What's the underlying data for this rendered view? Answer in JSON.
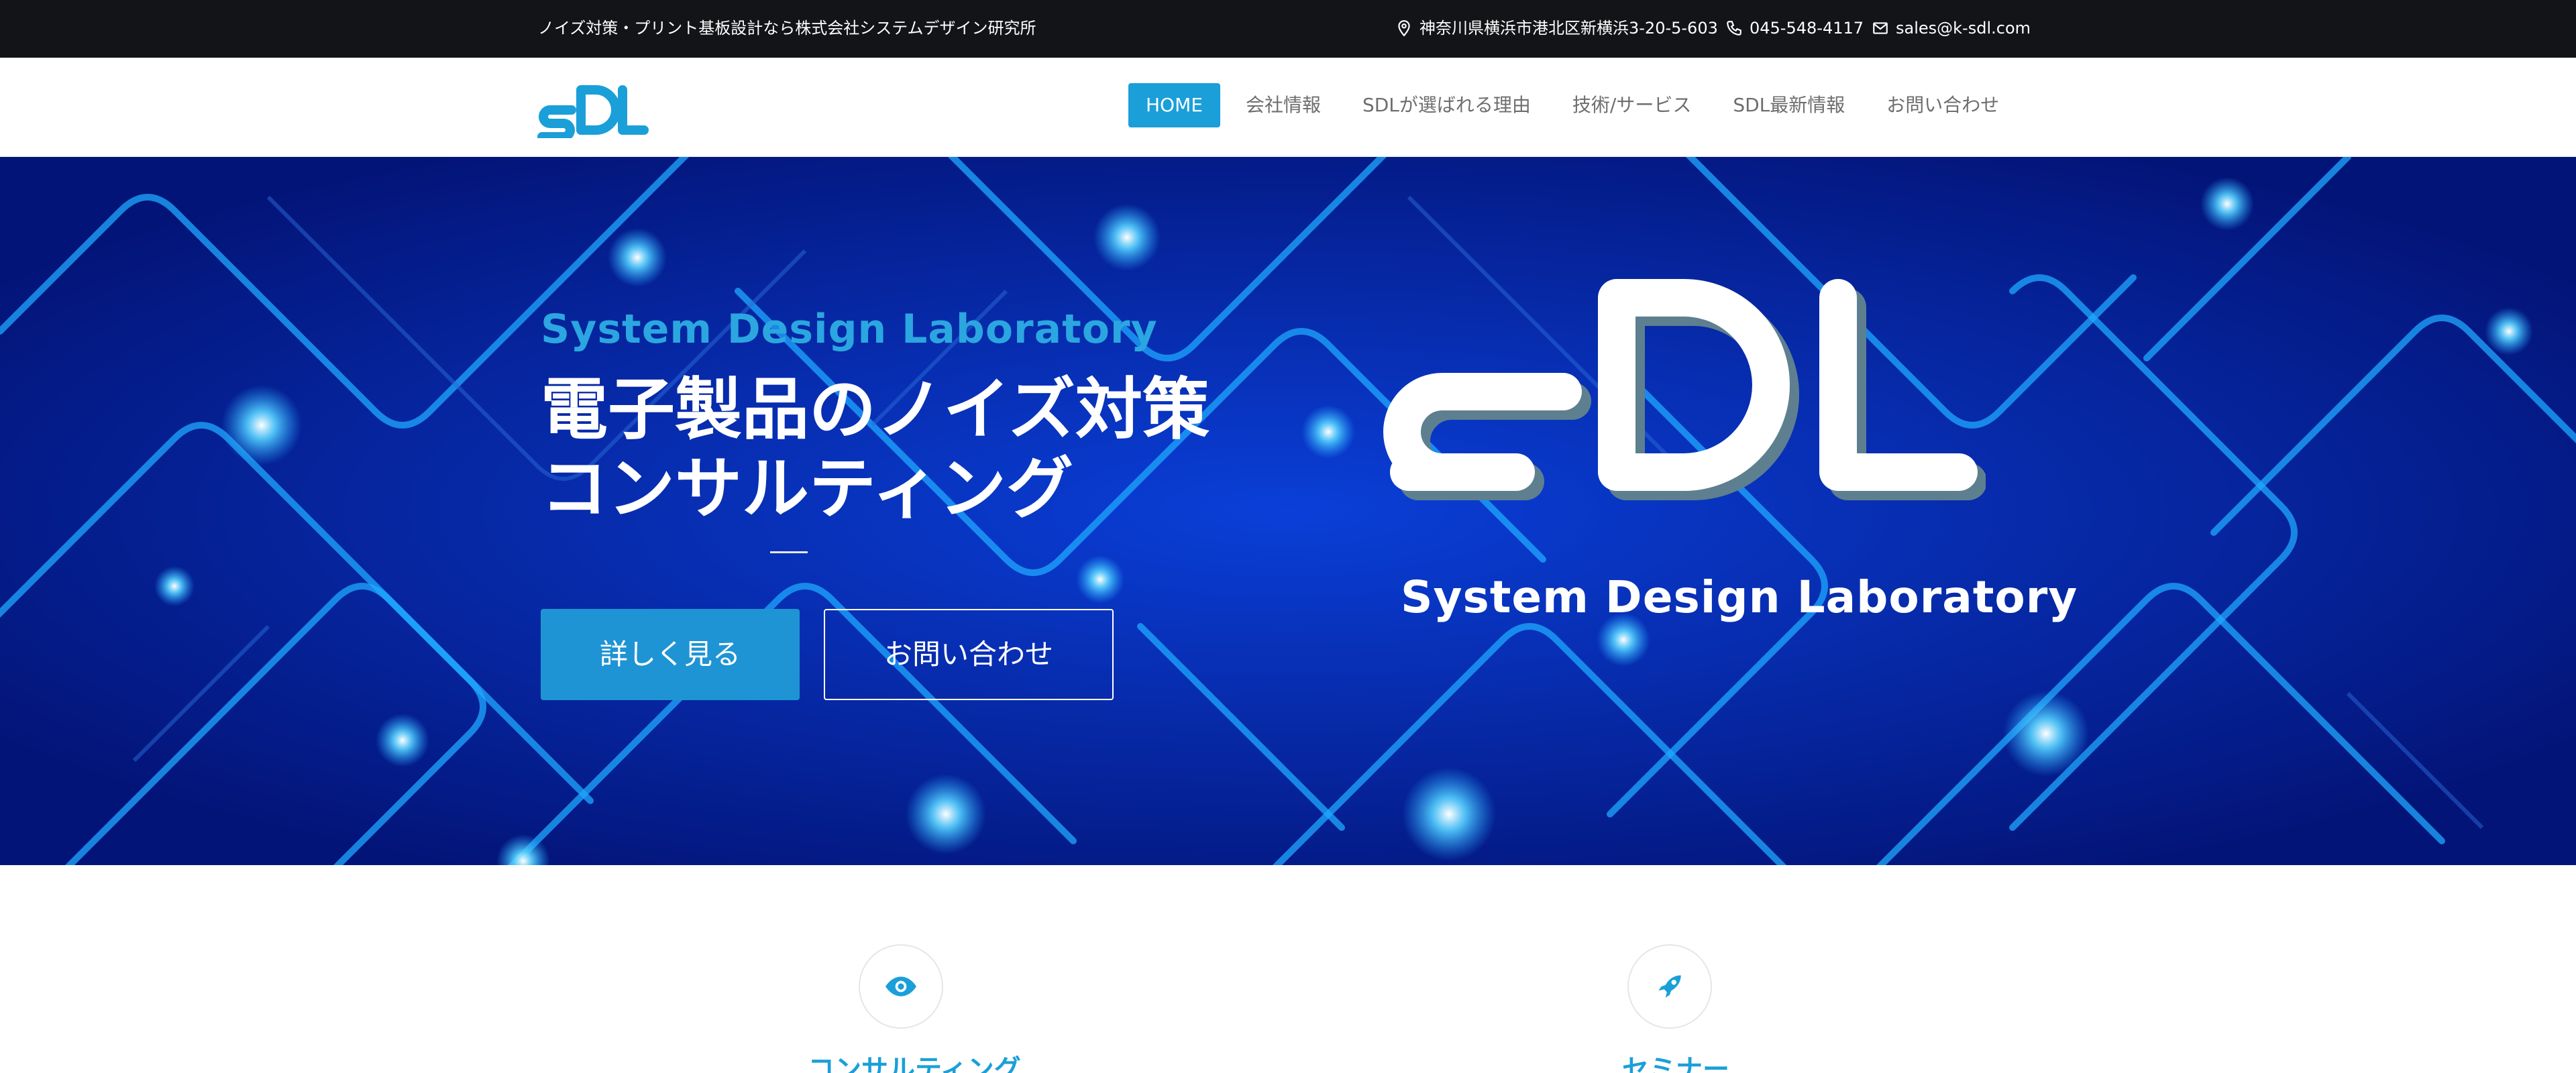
{
  "topbar": {
    "tagline": "ノイズ対策・プリント基板設計なら株式会社システムデザイン研究所",
    "address": "神奈川県横浜市港北区新横浜3-20-5-603",
    "phone": "045-548-4117",
    "email": "sales@k-sdl.com",
    "icons": [
      "map-pin-icon",
      "phone-icon",
      "mail-icon"
    ]
  },
  "header": {
    "logo_text": "SDL",
    "nav": [
      {
        "label": "HOME",
        "active": true
      },
      {
        "label": "会社情報",
        "active": false
      },
      {
        "label": "SDLが選ばれる理由",
        "active": false
      },
      {
        "label": "技術/サービス",
        "active": false
      },
      {
        "label": "SDL最新情報",
        "active": false
      },
      {
        "label": "お問い合わせ",
        "active": false
      }
    ]
  },
  "hero": {
    "subtitle": "System Design Laboratory",
    "title_line1": "電子製品のノイズ対策",
    "title_line2": "コンサルティング",
    "primary_button": "詳しく見る",
    "secondary_button": "お問い合わせ",
    "logo_text": "SDL",
    "logo_caption": "System Design Laboratory"
  },
  "features": [
    {
      "icon": "eye-icon",
      "title": "コンサルティング"
    },
    {
      "icon": "rocket-icon",
      "title": "セミナー"
    }
  ],
  "colors": {
    "accent": "#1a9fd9",
    "topbar_bg": "#131417",
    "hero_bg": "#05209a",
    "circuit_glow": "#1fa8ff",
    "nav_text": "#6e6e6e"
  }
}
